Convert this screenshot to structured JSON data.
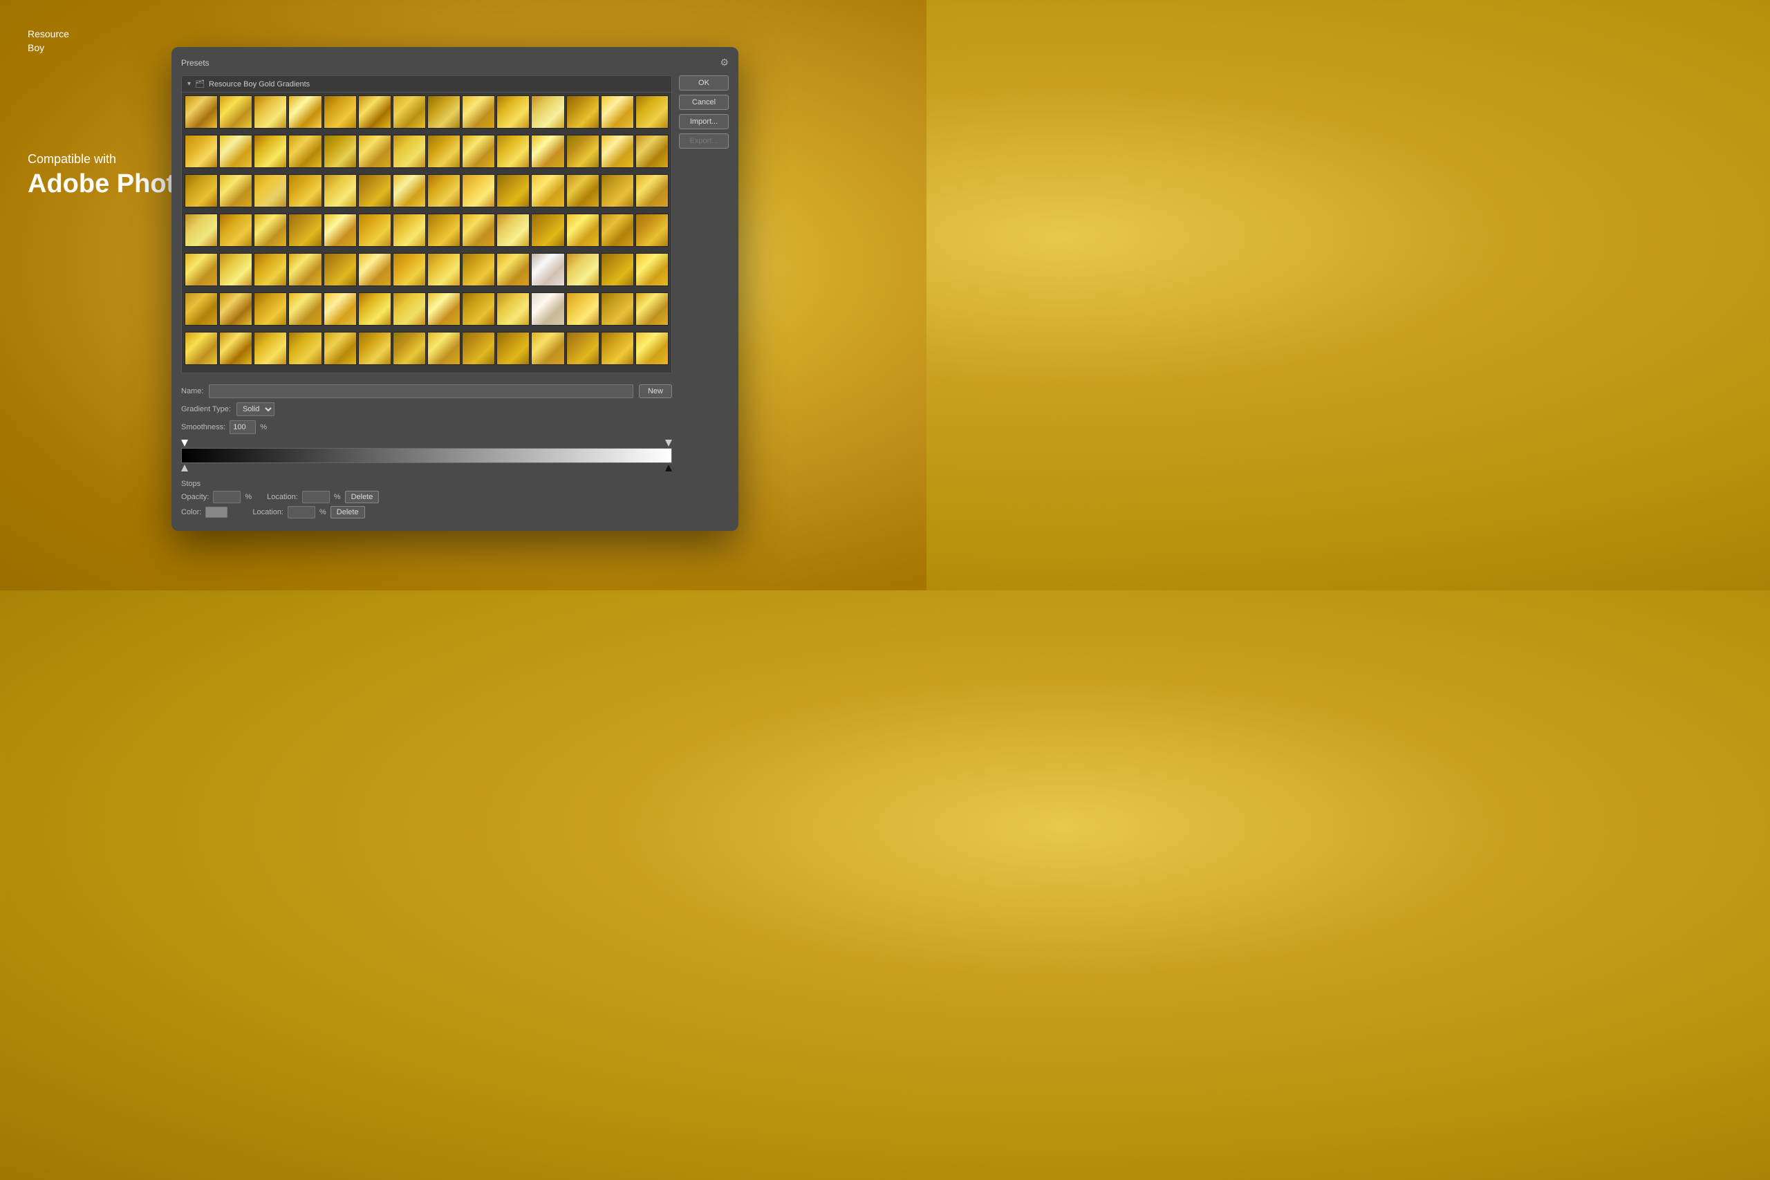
{
  "logo": {
    "line1": "Resource",
    "line2": "Boy"
  },
  "left_text": {
    "compatible": "Compatible with",
    "app_name": "Adobe Photoshop"
  },
  "dialog": {
    "presets_label": "Presets",
    "gear_icon": "⚙",
    "folder_arrow": "▾",
    "folder_icon": "📁",
    "folder_label": "Resource Boy Gold Gradients",
    "buttons": {
      "ok": "OK",
      "cancel": "Cancel",
      "import": "Import...",
      "export": "Export...",
      "new": "New"
    },
    "name_label": "Name:",
    "gradient_type_label": "Gradient Type:",
    "gradient_type_value": "Solid",
    "smoothness_label": "Smoothness:",
    "smoothness_value": "100",
    "smoothness_unit": "%",
    "stops_title": "Stops",
    "opacity_label": "Opacity:",
    "opacity_unit": "%",
    "location_label": "Location:",
    "location_unit": "%",
    "delete_label": "Delete",
    "color_label": "Color:"
  }
}
